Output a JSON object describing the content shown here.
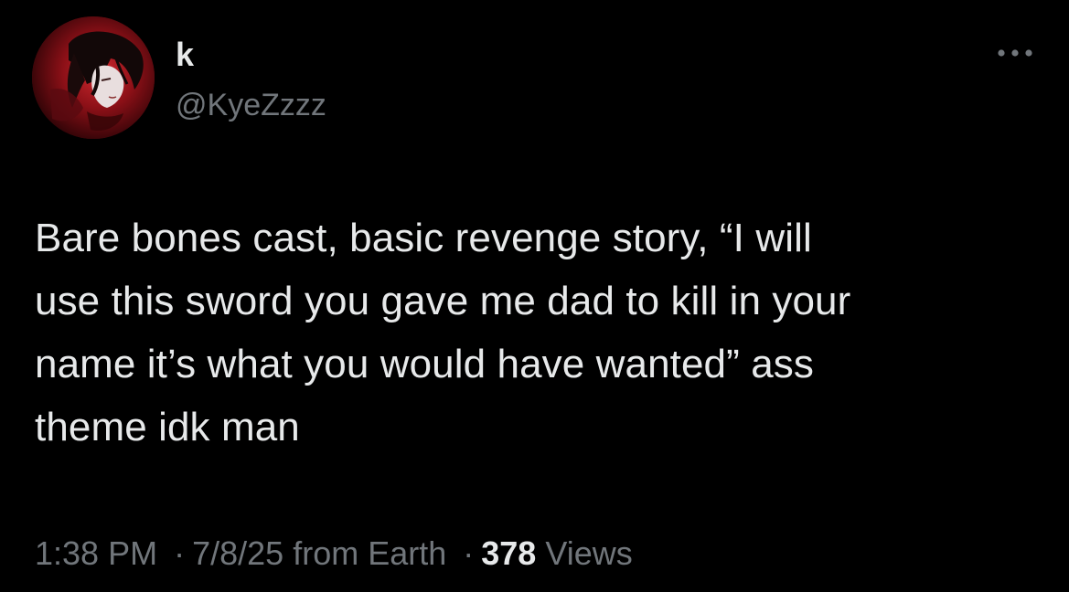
{
  "author": {
    "display_name": "k",
    "handle": "@KyeZzzz"
  },
  "tweet": {
    "text": "Bare bones cast, basic revenge story, “I will\nuse this sword you gave me dad to kill in your\nname it’s what you would have wanted” ass\ntheme idk man"
  },
  "meta": {
    "time": "1:38 PM",
    "separator": "·",
    "date": "7/8/25",
    "source": "from Earth",
    "views_count": "378",
    "views_label": "Views"
  },
  "icons": {
    "more": "more-horizontal-icon"
  },
  "colors": {
    "background": "#000000",
    "primary_text": "#e7e9ea",
    "secondary_text": "#71767b",
    "avatar_red": "#c0202a"
  }
}
